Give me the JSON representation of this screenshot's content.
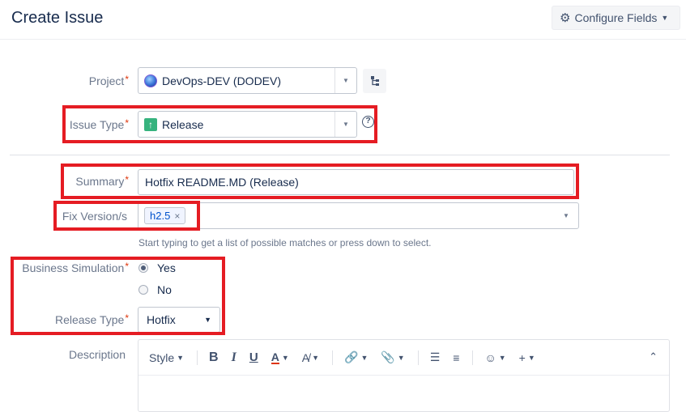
{
  "header": {
    "title": "Create Issue",
    "configure_label": "Configure Fields"
  },
  "form": {
    "project": {
      "label": "Project",
      "value": "DevOps-DEV (DODEV)"
    },
    "issue_type": {
      "label": "Issue Type",
      "value": "Release"
    },
    "summary": {
      "label": "Summary",
      "value": "Hotfix README.MD (Release)"
    },
    "fix_version": {
      "label": "Fix Version/s",
      "tags": [
        "h2.5"
      ],
      "hint": "Start typing to get a list of possible matches or press down to select."
    },
    "business_simulation": {
      "label": "Business Simulation",
      "options": [
        "Yes",
        "No"
      ],
      "selected": "Yes"
    },
    "release_type": {
      "label": "Release Type",
      "value": "Hotfix"
    },
    "description": {
      "label": "Description",
      "toolbar": {
        "style_label": "Style"
      }
    }
  },
  "colors": {
    "required_marker": "#de350b",
    "highlight_box": "#e51c23",
    "issue_type_icon": "#36b37e",
    "tag_text": "#0052cc"
  },
  "icons": {
    "project": "project-avatar-icon",
    "hierarchy": "hierarchy-icon",
    "issue_type": "release-arrow-icon",
    "help": "help-icon",
    "configure": "gear-icon"
  }
}
